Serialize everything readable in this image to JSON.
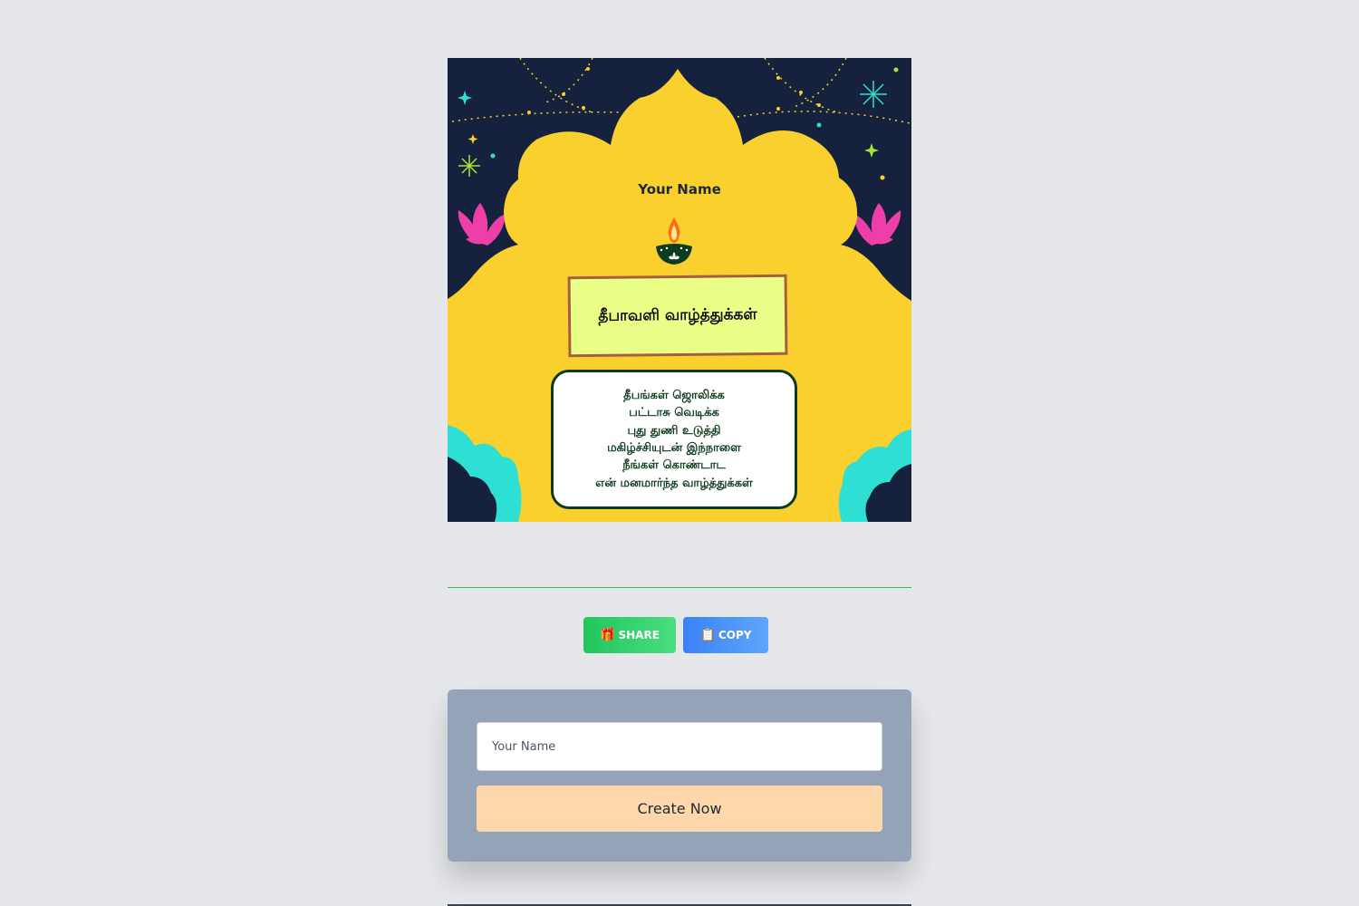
{
  "card": {
    "name": "Your Name",
    "title": "தீபாவளி வாழ்த்துக்கள்",
    "message_lines": [
      "தீபங்கள் ஜொலிக்க",
      "பட்டாசு வெடிக்க",
      "புது துணி உடுத்தி",
      "மகிழ்ச்சியுடன் இந்நாளை",
      "நீங்கள் கொண்டாட",
      "என் மனமார்ந்த வாழ்த்துக்கள்"
    ]
  },
  "actions": {
    "share_icon": "🎁",
    "share_label": "SHARE",
    "copy_icon": "📋",
    "copy_label": "COPY"
  },
  "form": {
    "name_placeholder": "Your Name",
    "name_value": "",
    "create_label": "Create Now"
  },
  "colors": {
    "page_bg": "#e5e7eb",
    "card_bg": "#16213e",
    "lotus_yellow": "#f9d02e",
    "teal_accent": "#2ee0d3",
    "pink_lotus": "#ee3fa8",
    "share_green": "#22c55e",
    "copy_blue": "#3b82f6",
    "panel_slate": "#94a3b8",
    "create_peach": "#fed7aa"
  }
}
